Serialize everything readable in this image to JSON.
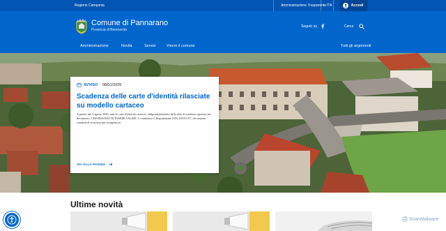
{
  "topbar": {
    "region": "Regione Campania",
    "links": [
      "Amministrazione Trasparente",
      "Albo Pretorio"
    ],
    "lang": "ITA",
    "login": "Accedi"
  },
  "header": {
    "title": "Comune di Pannarano",
    "subtitle": "Provincia di Benevento",
    "follow": "Seguici su",
    "search": "Cerca"
  },
  "nav": {
    "items": [
      "Amministrazione",
      "Novità",
      "Servizi",
      "Vivere il comune"
    ],
    "all": "Tutti gli argomenti"
  },
  "hero": {
    "category": "AVVISO",
    "date": "- 08/01/2026",
    "title": "Scadenza delle carte d'identità rilasciate su modello cartaceo",
    "body": "A partire dal 3 agosto 2026, tutte le carte d'identità cartacee, indipendentemente dalla data di scadenza riportata sul documento, CESSERANNO DI ESSERE VALIDE. Lo stabilisce il Regolamento (UE) 2019/1157, che impone standard di sicurezza più stringenti pe",
    "more": "VAI ALLA PAGINA"
  },
  "section": {
    "title": "Ultime novità"
  },
  "watermark": "ScanMalware",
  "colors": {
    "primary": "#0066cc",
    "dark": "#0054b3"
  }
}
